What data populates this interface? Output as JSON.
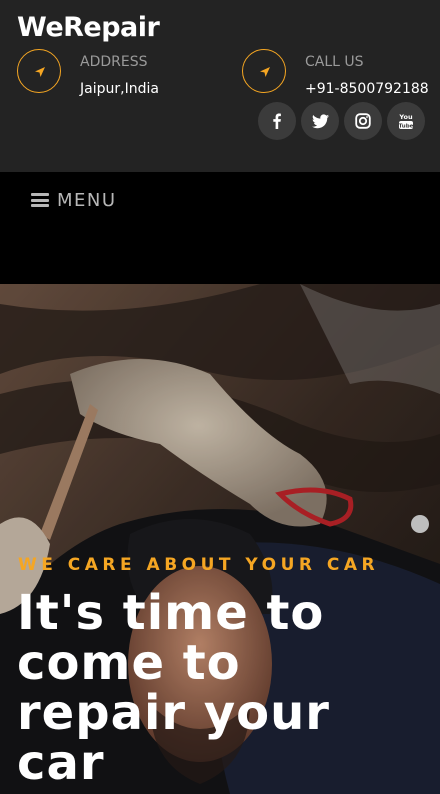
{
  "brand": "WeRepair",
  "address": {
    "label": "ADDRESS",
    "value": "Jaipur,India",
    "icon": "location-arrow-icon"
  },
  "call": {
    "label": "CALL US",
    "value": "+91-8500792188",
    "icon": "location-arrow-icon"
  },
  "socials": [
    {
      "name": "facebook",
      "glyph": "f"
    },
    {
      "name": "twitter"
    },
    {
      "name": "instagram"
    },
    {
      "name": "youtube",
      "glyph": "You Tube"
    }
  ],
  "menu": {
    "label": "MENU"
  },
  "hero": {
    "kicker": "WE CARE ABOUT YOUR CAR",
    "headline_lines": [
      "It's time to",
      "come to",
      "repair your",
      "car"
    ]
  },
  "colors": {
    "accent": "#f5a623",
    "topbar": "#232323",
    "menubar": "#000000"
  }
}
